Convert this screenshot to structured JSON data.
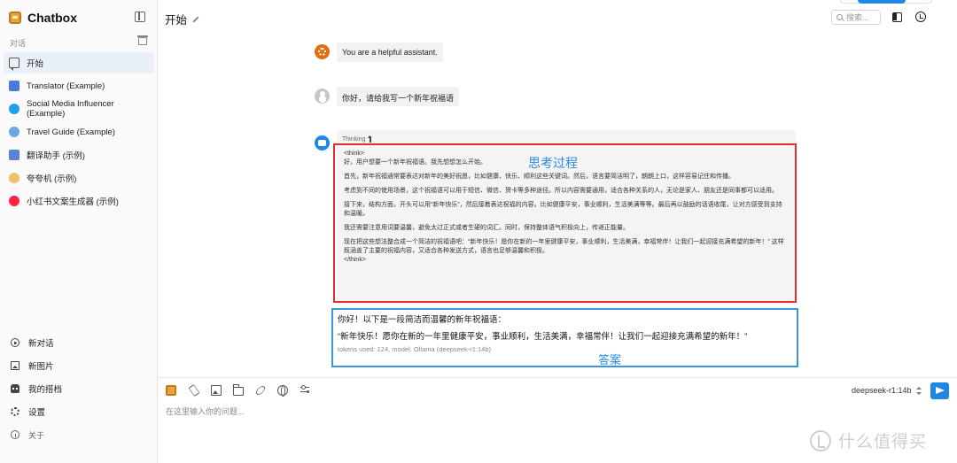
{
  "app": {
    "title": "Chatbox"
  },
  "sidebar": {
    "section_label": "对话",
    "conversations": [
      {
        "label": "开始",
        "icon": "chat-bubble-icon",
        "active": true,
        "color": ""
      },
      {
        "label": "Translator (Example)",
        "icon": "translator-avatar-icon",
        "active": false,
        "color": "#4a7bd8"
      },
      {
        "label": "Social Media Influencer (Example)",
        "icon": "twitter-avatar-icon",
        "active": false,
        "color": "#1da1f2"
      },
      {
        "label": "Travel Guide (Example)",
        "icon": "globe-avatar-icon",
        "active": false,
        "color": "#6fa7e0"
      },
      {
        "label": "翻译助手 (示例)",
        "icon": "translator-cn-avatar-icon",
        "active": false,
        "color": "#5b82d6"
      },
      {
        "label": "夸夸机 (示例)",
        "icon": "praise-avatar-icon",
        "active": false,
        "color": "#f0c070"
      },
      {
        "label": "小红书文案生成器 (示例)",
        "icon": "xiaohongshu-avatar-icon",
        "active": false,
        "color": "#ff2442"
      }
    ],
    "bottom_items": [
      {
        "label": "新对话",
        "icon": "plus-circle-icon"
      },
      {
        "label": "新图片",
        "icon": "image-icon"
      },
      {
        "label": "我的搭档",
        "icon": "bot-icon"
      },
      {
        "label": "设置",
        "icon": "gear-icon"
      },
      {
        "label": "关于",
        "icon": "info-icon"
      }
    ]
  },
  "header": {
    "title": "开始",
    "search_placeholder": "搜索..."
  },
  "messages": {
    "system": "You are a helpful assistant.",
    "user": "你好，请给我写一个新年祝福语",
    "thinking_label": "Thinking",
    "thinking_open_tag": "<think>",
    "thinking_close_tag": "</think>",
    "thinking_paragraphs": [
      "好，用户想要一个新年祝福语。我先想想怎么开始。",
      "首先，新年祝福通常要表达对新年的美好祝愿，比如健康、快乐、顺利这些关键词。然后，语言要简洁明了，朗朗上口，这样容易记住和传播。",
      "考虑到不同的使用场景，这个祝福语可以用于短信、微信、贺卡等多种途径。所以内容需要通用，适合各种关系的人，无论是家人、朋友还是同事都可以适用。",
      "接下来，结构方面，开头可以用“新年快乐”，然后接着表达祝福的内容。比如健康平安，事业顺利，生活美满等等。最后再以鼓励的话语收尾，让对方感受到支持和温暖。",
      "我还需要注意用词要温馨，避免太过正式或者生硬的词汇。同时，保持整体语气积极向上，传递正能量。",
      "现在把这些想法整合成一个简洁的祝福语吧：“新年快乐！愿你在新的一年里健康平安，事业顺利，生活美满，幸福常伴！让我们一起迎接充满希望的新年！” 这样既涵盖了主要的祝福内容，又适合各种发送方式，语言也足够温馨和积极。"
    ],
    "answer_intro": "你好！以下是一段简洁而温馨的新年祝福语：",
    "answer_body": "“新年快乐！愿你在新的一年里健康平安，事业顺利，生活美满，幸福常伴！让我们一起迎接充满希望的新年！”",
    "tokens_info": "tokens used: 124, model: Ollama (deepseek-r1:14b)"
  },
  "annotations": {
    "thinking_caption": "思考过程",
    "answer_caption": "答案",
    "thinking_frame_color": "#e52d2d",
    "answer_frame_color": "#3b95e3"
  },
  "composer": {
    "placeholder": "在这里输入你的问题...",
    "model": "deepseek-r1:14b"
  },
  "watermark": {
    "text": "什么值得买"
  },
  "colors": {
    "accent": "#1f87e5",
    "system_avatar": "#e06e12"
  }
}
